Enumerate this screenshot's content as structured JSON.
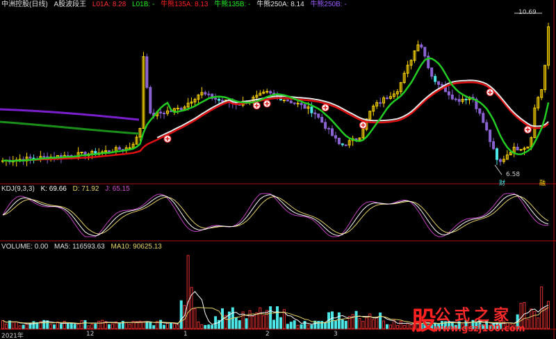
{
  "header": {
    "stock_name": "中洲控股(日线)",
    "indicator_name": "A股波段王",
    "l01a_label": "L01A: 8.28",
    "l01b_label": "L01B: -",
    "ma135_label": "牛熊135A: 8.13",
    "ma135b_label": "牛熊135B: -",
    "ma250a_label": "牛熊250A: 8.14",
    "ma250b_label": "牛熊250B: -"
  },
  "kdj_header": {
    "name": "KDJ(9,3,3)",
    "k_label": "K: 69.66",
    "d_label": "D: 71.92",
    "j_label": "J: 65.15"
  },
  "volume_header": {
    "name": "VOLUME: 0.00",
    "ma5_label": "MA5: 116593.63",
    "ma10_label": "MA10: 90625.13"
  },
  "annotations": {
    "high_price": "10.69",
    "low_price": "6.58",
    "low_tag": "财",
    "right_tag": "融"
  },
  "x_axis": {
    "ticks": [
      "2021年",
      "12",
      "1",
      "2",
      "3"
    ]
  },
  "watermark": {
    "logo_char": "股",
    "site_name": "公式之家",
    "url": "www.gszj100.com"
  },
  "colors": {
    "background": "#000000",
    "up": "#ffd700",
    "down": "#8a63d2",
    "cyan": "#4de6e6",
    "red_line": "#e01010",
    "green_line": "#22cc22",
    "purple_line": "#7a1fcc",
    "white_line": "#e6e6e6",
    "kdj_k": "#ffffff",
    "kdj_d": "#e6d36a",
    "kdj_j": "#c040c0",
    "separator": "#b01010"
  },
  "chart_data": [
    {
      "type": "candlestick",
      "panel": "main",
      "x_count": 160,
      "price_range": [
        6.4,
        10.9
      ],
      "high": 10.69,
      "low": 6.58,
      "series": [
        {
          "name": "L01A",
          "last": 8.28
        },
        {
          "name": "牛熊135A",
          "last": 8.13
        },
        {
          "name": "牛熊250A",
          "last": 8.14
        }
      ]
    },
    {
      "type": "line",
      "panel": "kdj",
      "series": [
        {
          "name": "K",
          "last": 69.66
        },
        {
          "name": "D",
          "last": 71.92
        },
        {
          "name": "J",
          "last": 65.15
        }
      ],
      "ylim": [
        0,
        100
      ]
    },
    {
      "type": "bar",
      "panel": "volume",
      "series": [
        {
          "name": "MA5",
          "last": 116593.63
        },
        {
          "name": "MA10",
          "last": 90625.13
        }
      ]
    }
  ]
}
